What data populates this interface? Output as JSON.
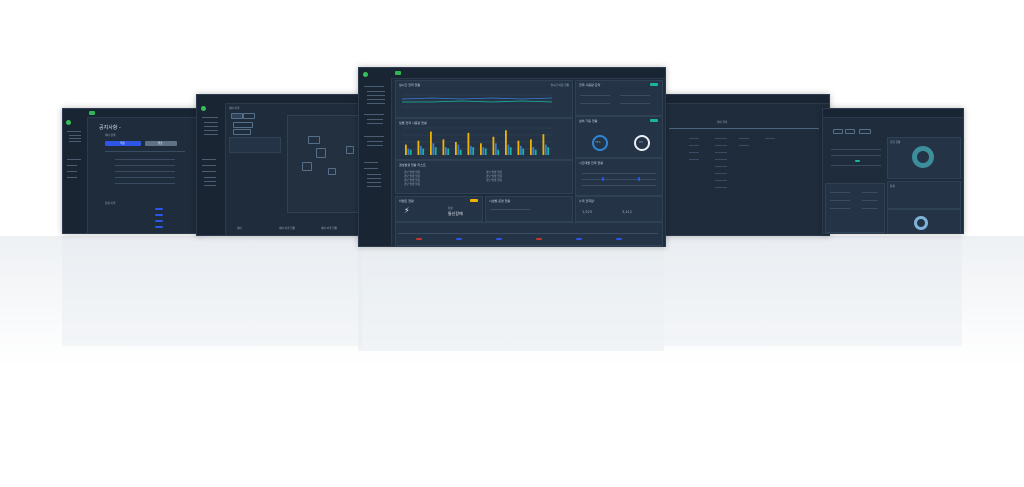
{
  "screens": {
    "center": {
      "panels": {
        "line_chart": {
          "title": "실시간 전력 현황",
          "legend": "실시간 이용 현황"
        },
        "bar_chart": {
          "title": "월별 전력 사용량 현황"
        },
        "alarm_list": {
          "title": "경보발생 현황 리스트"
        },
        "event": {
          "title": "이벤트 현황",
          "status": "정상",
          "value": "통신장애"
        },
        "facility": {
          "title": "시설별 운영 현황"
        },
        "right_top": {
          "title": "전력 사용량 요약"
        },
        "right_mid": {
          "title": "설비 가동 현황",
          "gauge_a": "75%",
          "gauge_b": "0%"
        },
        "right_chart": {
          "title": "시간대별 전력 현황"
        },
        "right_bottom": {
          "title": "누적 전력량",
          "value_a": "1,523",
          "value_b": "3,412"
        }
      },
      "alarm_rows": [
        "경보 발생 알림",
        "경보 발생 알림",
        "경보 발생 알림",
        "경보 발생 알림",
        "경보 발생 알림",
        "경보 발생 알림",
        "경보 발생 알림"
      ]
    },
    "left2": {
      "title": "공지사항 -",
      "panel_title": "제어 상태",
      "buttons": {
        "primary": "적용",
        "secondary": "취소"
      },
      "panel2_title": "설정 이력"
    },
    "left1": {
      "panel_title": "제어 이력",
      "footer": [
        "제어",
        "제어 이력 현황",
        "제어 이력 현황"
      ]
    },
    "right1": {
      "table_title": "설비 목록"
    },
    "right2": {
      "panel_title": "운영 현황",
      "panel2_title": "통계"
    }
  },
  "colors": {
    "bg": "#1f2c3b",
    "accent_green": "#35c05a",
    "bar_yellow": "#f0b400",
    "bar_blue": "#3a7bd5",
    "bar_teal": "#19b59c",
    "button_blue": "#2d56e6"
  },
  "chart_data": {
    "type": "bar",
    "categories": [
      "1",
      "2",
      "3",
      "4",
      "5",
      "6",
      "7",
      "8",
      "9",
      "10",
      "11",
      "12"
    ],
    "series": [
      {
        "values": [
          40,
          55,
          90,
          60,
          50,
          85,
          45,
          70,
          95,
          55,
          60,
          80
        ]
      },
      {
        "values": [
          25,
          35,
          45,
          30,
          40,
          35,
          30,
          45,
          40,
          35,
          30,
          40
        ]
      },
      {
        "values": [
          20,
          25,
          30,
          25,
          20,
          30,
          25,
          20,
          30,
          25,
          20,
          30
        ]
      }
    ]
  }
}
